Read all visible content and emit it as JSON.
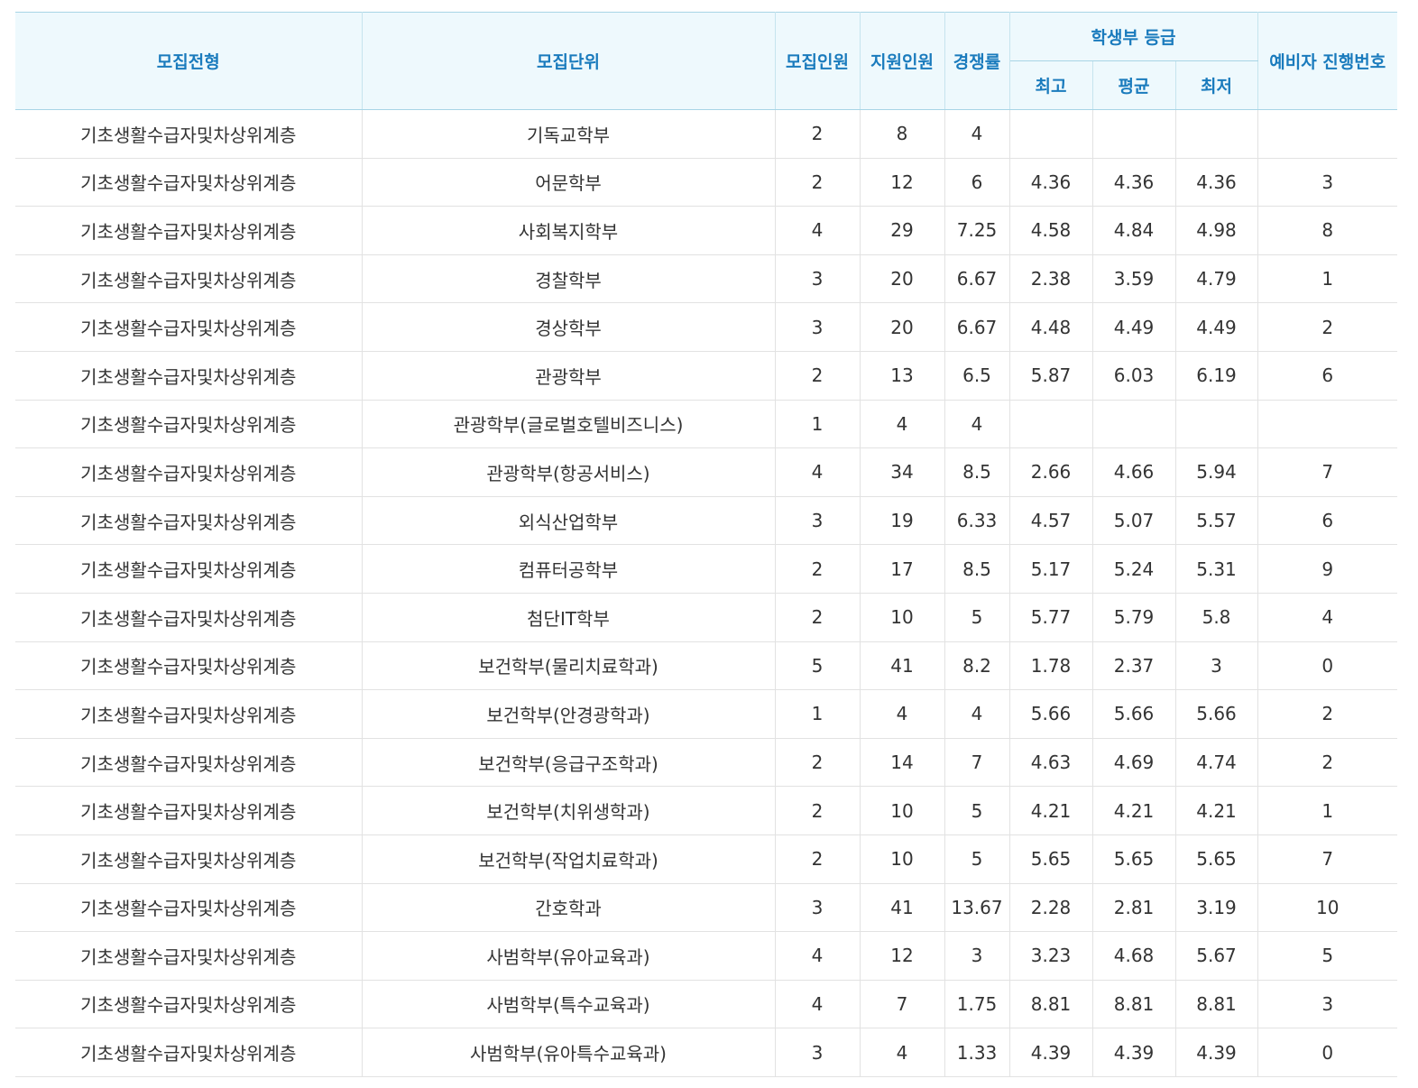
{
  "table": {
    "headers": {
      "type": "모집전형",
      "unit": "모집단위",
      "quota": "모집인원",
      "applicants": "지원인원",
      "ratio": "경쟁률",
      "grade_group": "학생부 등급",
      "grade_max": "최고",
      "grade_avg": "평균",
      "grade_min": "최저",
      "waitlist": "예비자 진행번호"
    },
    "rows": [
      [
        "기초생활수급자및차상위계층",
        "기독교학부",
        "2",
        "8",
        "4",
        "",
        "",
        "",
        ""
      ],
      [
        "기초생활수급자및차상위계층",
        "어문학부",
        "2",
        "12",
        "6",
        "4.36",
        "4.36",
        "4.36",
        "3"
      ],
      [
        "기초생활수급자및차상위계층",
        "사회복지학부",
        "4",
        "29",
        "7.25",
        "4.58",
        "4.84",
        "4.98",
        "8"
      ],
      [
        "기초생활수급자및차상위계층",
        "경찰학부",
        "3",
        "20",
        "6.67",
        "2.38",
        "3.59",
        "4.79",
        "1"
      ],
      [
        "기초생활수급자및차상위계층",
        "경상학부",
        "3",
        "20",
        "6.67",
        "4.48",
        "4.49",
        "4.49",
        "2"
      ],
      [
        "기초생활수급자및차상위계층",
        "관광학부",
        "2",
        "13",
        "6.5",
        "5.87",
        "6.03",
        "6.19",
        "6"
      ],
      [
        "기초생활수급자및차상위계층",
        "관광학부(글로벌호텔비즈니스)",
        "1",
        "4",
        "4",
        "",
        "",
        "",
        ""
      ],
      [
        "기초생활수급자및차상위계층",
        "관광학부(항공서비스)",
        "4",
        "34",
        "8.5",
        "2.66",
        "4.66",
        "5.94",
        "7"
      ],
      [
        "기초생활수급자및차상위계층",
        "외식산업학부",
        "3",
        "19",
        "6.33",
        "4.57",
        "5.07",
        "5.57",
        "6"
      ],
      [
        "기초생활수급자및차상위계층",
        "컴퓨터공학부",
        "2",
        "17",
        "8.5",
        "5.17",
        "5.24",
        "5.31",
        "9"
      ],
      [
        "기초생활수급자및차상위계층",
        "첨단IT학부",
        "2",
        "10",
        "5",
        "5.77",
        "5.79",
        "5.8",
        "4"
      ],
      [
        "기초생활수급자및차상위계층",
        "보건학부(물리치료학과)",
        "5",
        "41",
        "8.2",
        "1.78",
        "2.37",
        "3",
        "0"
      ],
      [
        "기초생활수급자및차상위계층",
        "보건학부(안경광학과)",
        "1",
        "4",
        "4",
        "5.66",
        "5.66",
        "5.66",
        "2"
      ],
      [
        "기초생활수급자및차상위계층",
        "보건학부(응급구조학과)",
        "2",
        "14",
        "7",
        "4.63",
        "4.69",
        "4.74",
        "2"
      ],
      [
        "기초생활수급자및차상위계층",
        "보건학부(치위생학과)",
        "2",
        "10",
        "5",
        "4.21",
        "4.21",
        "4.21",
        "1"
      ],
      [
        "기초생활수급자및차상위계층",
        "보건학부(작업치료학과)",
        "2",
        "10",
        "5",
        "5.65",
        "5.65",
        "5.65",
        "7"
      ],
      [
        "기초생활수급자및차상위계층",
        "간호학과",
        "3",
        "41",
        "13.67",
        "2.28",
        "2.81",
        "3.19",
        "10"
      ],
      [
        "기초생활수급자및차상위계층",
        "사범학부(유아교육과)",
        "4",
        "12",
        "3",
        "3.23",
        "4.68",
        "5.67",
        "5"
      ],
      [
        "기초생활수급자및차상위계층",
        "사범학부(특수교육과)",
        "4",
        "7",
        "1.75",
        "8.81",
        "8.81",
        "8.81",
        "3"
      ],
      [
        "기초생활수급자및차상위계층",
        "사범학부(유아특수교육과)",
        "3",
        "4",
        "1.33",
        "4.39",
        "4.39",
        "4.39",
        "0"
      ]
    ]
  },
  "colors": {
    "header_bg": "#eef9fd",
    "header_text": "#1a7bbd",
    "body_text": "#333333",
    "grid_line": "#e2e2e2"
  }
}
